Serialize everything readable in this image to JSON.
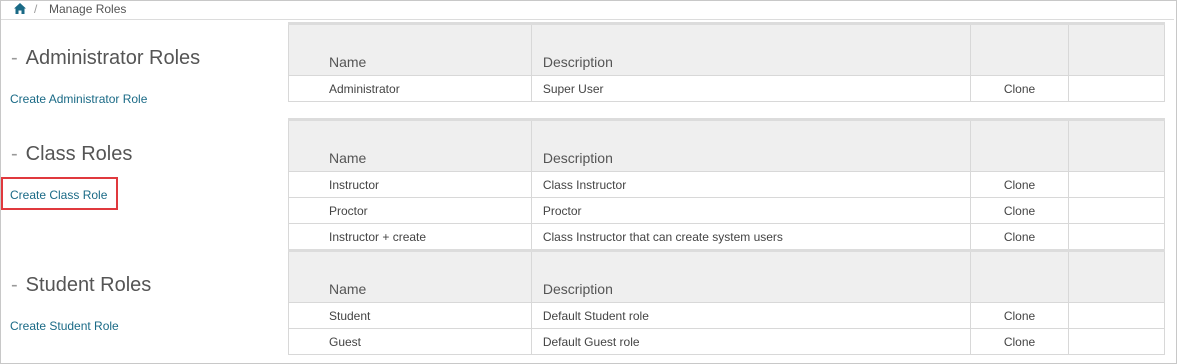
{
  "breadcrumb": {
    "separator": "/",
    "current": "Manage Roles"
  },
  "sections": {
    "admin": {
      "title": "Administrator Roles",
      "create_label": "Create Administrator Role",
      "headers": {
        "name": "Name",
        "description": "Description"
      },
      "rows": [
        {
          "name": "Administrator",
          "description": "Super User",
          "action": "Clone"
        }
      ]
    },
    "class": {
      "title": "Class Roles",
      "create_label": "Create Class Role",
      "headers": {
        "name": "Name",
        "description": "Description"
      },
      "rows": [
        {
          "name": "Instructor",
          "description": "Class Instructor",
          "action": "Clone"
        },
        {
          "name": "Proctor",
          "description": "Proctor",
          "action": "Clone"
        },
        {
          "name": "Instructor + create",
          "description": "Class Instructor that can create system users",
          "action": "Clone"
        }
      ]
    },
    "student": {
      "title": "Student Roles",
      "create_label": "Create Student Role",
      "headers": {
        "name": "Name",
        "description": "Description"
      },
      "rows": [
        {
          "name": "Student",
          "description": "Default Student role",
          "action": "Clone"
        },
        {
          "name": "Guest",
          "description": "Default Guest role",
          "action": "Clone"
        }
      ]
    }
  },
  "icons": {
    "home": "home-icon",
    "section_marker": "dash"
  },
  "colors": {
    "link": "#1a6a86",
    "highlight": "#e0393e",
    "header_bg": "#efefef"
  }
}
